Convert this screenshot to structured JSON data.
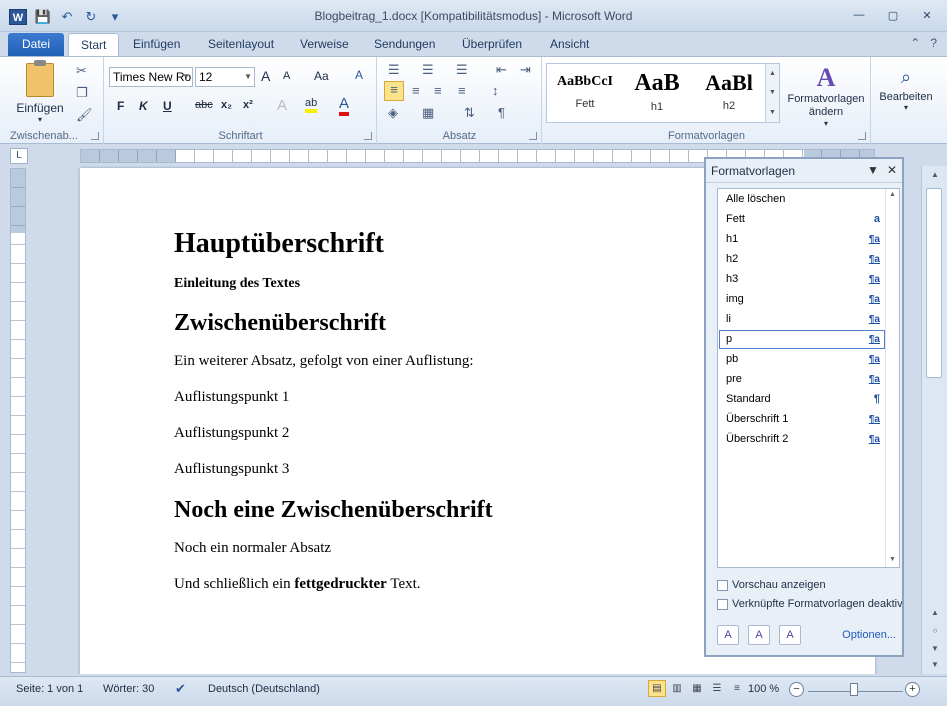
{
  "window": {
    "title": "Blogbeitrag_1.docx [Kompatibilitätsmodus]  -  Microsoft Word",
    "app_icon_letter": "W",
    "controls": {
      "minimize": "—",
      "maximize": "▢",
      "close": "✕"
    }
  },
  "qat": {
    "save": "💾",
    "undo": "↶",
    "redo": "↻",
    "customize": "▾"
  },
  "tabs": {
    "file": "Datei",
    "items": [
      "Start",
      "Einfügen",
      "Seitenlayout",
      "Verweise",
      "Sendungen",
      "Überprüfen",
      "Ansicht"
    ],
    "active": "Start",
    "help": "?",
    "collapse": "⌃"
  },
  "ribbon": {
    "clipboard": {
      "label": "Zwischenab...",
      "paste": "Einfügen"
    },
    "font": {
      "label": "Schriftart",
      "font_name": "Times New Roman",
      "font_size": "12",
      "bold": "F",
      "italic": "K",
      "underline": "U",
      "strike": "abc",
      "sub": "x₂",
      "sup": "x²",
      "grow": "A",
      "shrink": "A",
      "case": "Aa",
      "clear": "A"
    },
    "paragraph": {
      "label": "Absatz"
    },
    "styles": {
      "label": "Formatvorlagen",
      "items": [
        {
          "sample": "AaBbCcI",
          "caption": "Fett"
        },
        {
          "sample": "AaB",
          "caption": "h1"
        },
        {
          "sample": "AaBl",
          "caption": "h2"
        }
      ],
      "change": "Formatvorlagen ändern"
    },
    "editing": {
      "label": "Bearbeiten"
    }
  },
  "document": {
    "h1": "Hauptüberschrift",
    "intro": "Einleitung des Textes",
    "h2_1": "Zwischenüberschrift",
    "p1": "Ein weiterer Absatz, gefolgt von einer Auflistung:",
    "li1": "Auflistungspunkt 1",
    "li2": "Auflistungspunkt 2",
    "li3": "Auflistungspunkt 3",
    "h2_2": "Noch eine Zwischenüberschrift",
    "p2": "Noch ein normaler Absatz",
    "p3_pre": "Und schließlich  ein ",
    "p3_bold": "fettgedruckter",
    "p3_post": " Text."
  },
  "styles_pane": {
    "title": "Formatvorlagen",
    "items": [
      {
        "name": "Alle löschen",
        "mark": ""
      },
      {
        "name": "Fett",
        "mark": "a"
      },
      {
        "name": "h1",
        "mark": "¶a"
      },
      {
        "name": "h2",
        "mark": "¶a"
      },
      {
        "name": "h3",
        "mark": "¶a"
      },
      {
        "name": "img",
        "mark": "¶a"
      },
      {
        "name": "li",
        "mark": "¶a"
      },
      {
        "name": "p",
        "mark": "¶a"
      },
      {
        "name": "pb",
        "mark": "¶a"
      },
      {
        "name": "pre",
        "mark": "¶a"
      },
      {
        "name": "Standard",
        "mark": "¶"
      },
      {
        "name": "Überschrift 1",
        "mark": "¶a"
      },
      {
        "name": "Überschrift 2",
        "mark": "¶a"
      }
    ],
    "selected": "p",
    "preview_label": "Vorschau anzeigen",
    "linked_label": "Verknüpfte Formatvorlagen deaktivieren",
    "options_label": "Optionen..."
  },
  "status": {
    "page": "Seite: 1 von 1",
    "words": "Wörter: 30",
    "language": "Deutsch (Deutschland)",
    "zoom": "100 %"
  }
}
